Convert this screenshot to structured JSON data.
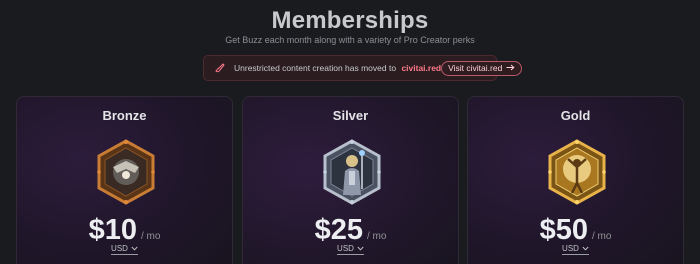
{
  "header": {
    "title": "Memberships",
    "subtitle": "Get Buzz each month along with a variety of Pro Creator perks"
  },
  "banner": {
    "icon": "brush-icon",
    "text": "Unrestricted content creation has moved to",
    "link": "civitai.red",
    "button_label": "Visit civitai.red",
    "button_icon": "arrow-right-icon",
    "accent_color": "#ff7a8a"
  },
  "tiers": [
    {
      "name": "Bronze",
      "price": "$10",
      "period": "/ mo",
      "currency": "USD",
      "badge_icon": "bronze-badge-icon",
      "accent": "#b8702c"
    },
    {
      "name": "Silver",
      "price": "$25",
      "period": "/ mo",
      "currency": "USD",
      "badge_icon": "silver-badge-icon",
      "accent": "#9aa6b8"
    },
    {
      "name": "Gold",
      "price": "$50",
      "period": "/ mo",
      "currency": "USD",
      "badge_icon": "gold-badge-icon",
      "accent": "#e0a93a"
    }
  ]
}
